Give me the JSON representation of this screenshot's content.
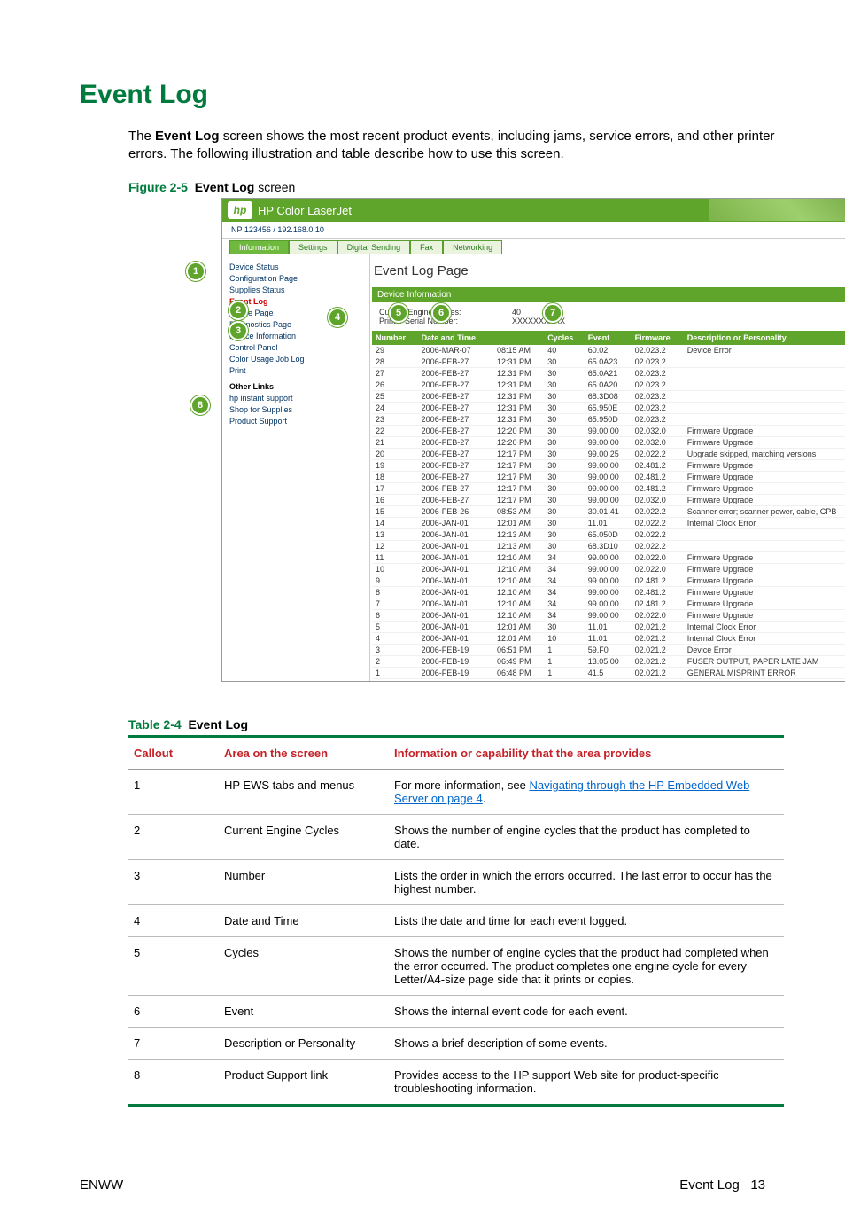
{
  "heading": "Event Log",
  "intro_pre": "The ",
  "intro_bold": "Event Log",
  "intro_post": " screen shows the most recent product events, including jams, service errors, and other printer errors. The following illustration and table describe how to use this screen.",
  "figure": {
    "label": "Figure 2-5",
    "bold": "Event Log",
    "rest": " screen"
  },
  "ss": {
    "brand_title": "HP Color LaserJet",
    "sub": "NP 123456 / 192.168.0.10",
    "tabs": [
      "Information",
      "Settings",
      "Digital Sending",
      "Fax",
      "Networking"
    ],
    "side_top": [
      "Device Status",
      "Configuration Page",
      "Supplies Status"
    ],
    "side_sel": "Event Log",
    "side_after": [
      "Usage Page",
      "Diagnostics Page",
      "Device Information",
      "Control Panel",
      "Color Usage Job Log",
      "Print"
    ],
    "side_group": "Other Links",
    "side_links": [
      "hp instant support",
      "Shop for Supplies",
      "Product Support"
    ],
    "main_title": "Event Log Page",
    "panel_head": "Device Information",
    "meta": {
      "l1": "Current Engine Cycles:",
      "v1": "40",
      "l2": "Printer Serial Number:",
      "v2": "XXXXXXXXXX"
    },
    "cols": [
      "Number",
      "Date and Time",
      "",
      "Cycles",
      "Event",
      "Firmware",
      "Description or Personality"
    ],
    "rows": [
      [
        "29",
        "2006-MAR-07",
        "08:15 AM",
        "40",
        "60.02",
        "02.023.2",
        "Device Error"
      ],
      [
        "28",
        "2006-FEB-27",
        "12:31 PM",
        "30",
        "65.0A23",
        "02.023.2",
        ""
      ],
      [
        "27",
        "2006-FEB-27",
        "12:31 PM",
        "30",
        "65.0A21",
        "02.023.2",
        ""
      ],
      [
        "26",
        "2006-FEB-27",
        "12:31 PM",
        "30",
        "65.0A20",
        "02.023.2",
        ""
      ],
      [
        "25",
        "2006-FEB-27",
        "12:31 PM",
        "30",
        "68.3D08",
        "02.023.2",
        ""
      ],
      [
        "24",
        "2006-FEB-27",
        "12:31 PM",
        "30",
        "65.950E",
        "02.023.2",
        ""
      ],
      [
        "23",
        "2006-FEB-27",
        "12:31 PM",
        "30",
        "65.950D",
        "02.023.2",
        ""
      ],
      [
        "22",
        "2006-FEB-27",
        "12:20 PM",
        "30",
        "99.00.00",
        "02.032.0",
        "Firmware Upgrade"
      ],
      [
        "21",
        "2006-FEB-27",
        "12:20 PM",
        "30",
        "99.00.00",
        "02.032.0",
        "Firmware Upgrade"
      ],
      [
        "20",
        "2006-FEB-27",
        "12:17 PM",
        "30",
        "99.00.25",
        "02.022.2",
        "Upgrade skipped, matching versions"
      ],
      [
        "19",
        "2006-FEB-27",
        "12:17 PM",
        "30",
        "99.00.00",
        "02.481.2",
        "Firmware Upgrade"
      ],
      [
        "18",
        "2006-FEB-27",
        "12:17 PM",
        "30",
        "99.00.00",
        "02.481.2",
        "Firmware Upgrade"
      ],
      [
        "17",
        "2006-FEB-27",
        "12:17 PM",
        "30",
        "99.00.00",
        "02.481.2",
        "Firmware Upgrade"
      ],
      [
        "16",
        "2006-FEB-27",
        "12:17 PM",
        "30",
        "99.00.00",
        "02.032.0",
        "Firmware Upgrade"
      ],
      [
        "15",
        "2006-FEB-26",
        "08:53 AM",
        "30",
        "30.01.41",
        "02.022.2",
        "Scanner error; scanner power, cable, CPB"
      ],
      [
        "14",
        "2006-JAN-01",
        "12:01 AM",
        "30",
        "11.01",
        "02.022.2",
        "Internal Clock Error"
      ],
      [
        "13",
        "2006-JAN-01",
        "12:13 AM",
        "30",
        "65.050D",
        "02.022.2",
        ""
      ],
      [
        "12",
        "2006-JAN-01",
        "12:13 AM",
        "30",
        "68.3D10",
        "02.022.2",
        ""
      ],
      [
        "11",
        "2006-JAN-01",
        "12:10 AM",
        "34",
        "99.00.00",
        "02.022.0",
        "Firmware Upgrade"
      ],
      [
        "10",
        "2006-JAN-01",
        "12:10 AM",
        "34",
        "99.00.00",
        "02.022.0",
        "Firmware Upgrade"
      ],
      [
        "9",
        "2006-JAN-01",
        "12:10 AM",
        "34",
        "99.00.00",
        "02.481.2",
        "Firmware Upgrade"
      ],
      [
        "8",
        "2006-JAN-01",
        "12:10 AM",
        "34",
        "99.00.00",
        "02.481.2",
        "Firmware Upgrade"
      ],
      [
        "7",
        "2006-JAN-01",
        "12:10 AM",
        "34",
        "99.00.00",
        "02.481.2",
        "Firmware Upgrade"
      ],
      [
        "6",
        "2006-JAN-01",
        "12:10 AM",
        "34",
        "99.00.00",
        "02.022.0",
        "Firmware Upgrade"
      ],
      [
        "5",
        "2006-JAN-01",
        "12:01 AM",
        "30",
        "11.01",
        "02.021.2",
        "Internal Clock Error"
      ],
      [
        "4",
        "2006-JAN-01",
        "12:01 AM",
        "10",
        "11.01",
        "02.021.2",
        "Internal Clock Error"
      ],
      [
        "3",
        "2006-FEB-19",
        "06:51 PM",
        "1",
        "59.F0",
        "02.021.2",
        "Device Error"
      ],
      [
        "2",
        "2006-FEB-19",
        "06:49 PM",
        "1",
        "13.05.00",
        "02.021.2",
        "FUSER OUTPUT, PAPER LATE JAM"
      ],
      [
        "1",
        "2006-FEB-19",
        "06:48 PM",
        "1",
        "41.5",
        "02.021.2",
        "GENERAL MISPRINT ERROR"
      ]
    ]
  },
  "table": {
    "caption_label": "Table 2-4",
    "caption_bold": "Event Log",
    "head": [
      "Callout",
      "Area on the screen",
      "Information or capability that the area provides"
    ],
    "rows": [
      {
        "c": "1",
        "a": "HP EWS tabs and menus",
        "i_pre": "For more information, see ",
        "i_link": "Navigating through the HP Embedded Web Server on page 4",
        "i_post": "."
      },
      {
        "c": "2",
        "a": "Current Engine Cycles",
        "i": "Shows the number of engine cycles that the product has completed to date."
      },
      {
        "c": "3",
        "a": "Number",
        "i": "Lists the order in which the errors occurred. The last error to occur has the highest number."
      },
      {
        "c": "4",
        "a": "Date and Time",
        "i": "Lists the date and time for each event logged."
      },
      {
        "c": "5",
        "a": "Cycles",
        "i": "Shows the number of engine cycles that the product had completed when the error occurred. The product completes one engine cycle for every Letter/A4-size page side that it prints or copies."
      },
      {
        "c": "6",
        "a": "Event",
        "i": "Shows the internal event code for each event."
      },
      {
        "c": "7",
        "a": "Description or Personality",
        "i": "Shows a brief description of some events."
      },
      {
        "c": "8",
        "a": "Product Support link",
        "i": "Provides access to the HP support Web site for product-specific troubleshooting information."
      }
    ]
  },
  "footer": {
    "left": "ENWW",
    "right_text": "Event Log",
    "right_num": "13"
  }
}
